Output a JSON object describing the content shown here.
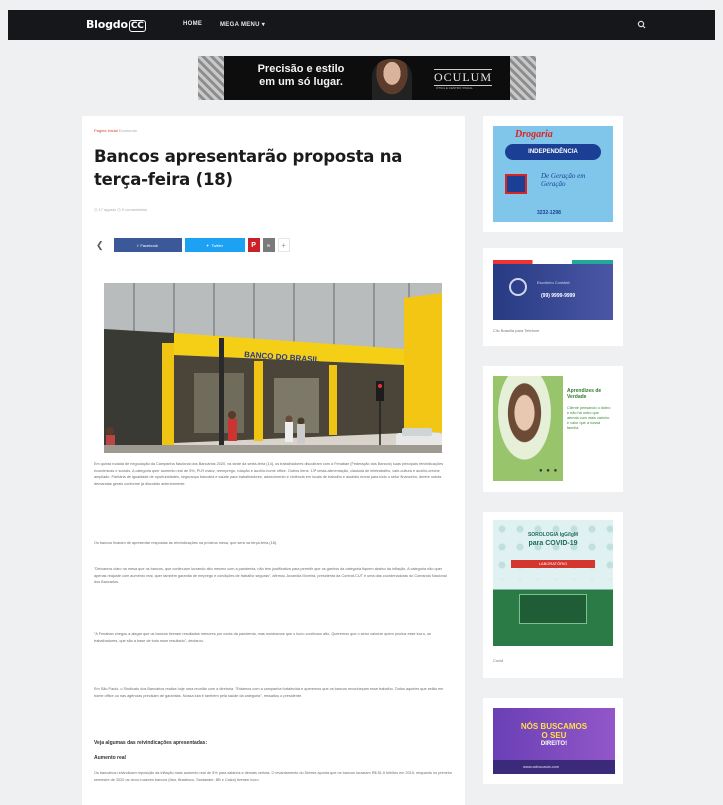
{
  "header": {
    "logo_text": "BlogdoCC",
    "logo_prefix": "Blogdo",
    "logo_mark": "CC",
    "nav": [
      "HOME",
      "MEGA MENU ▾"
    ],
    "search_icon": "search-icon"
  },
  "banner_ad": {
    "slogan_line1": "Precisão e estilo",
    "slogan_line2": "em um só lugar.",
    "brand": "OCULUM",
    "brand_sub": "ÓTICA E CENTRO VISUAL"
  },
  "article": {
    "category": "Pagina Inicial",
    "breadcrumb_sub": "Economia",
    "title": "Bancos apresentarão proposta na terça-feira (18)",
    "meta": "◷ 17 agosto  ◷ 0 comentários",
    "share": {
      "facebook": "Facebook",
      "twitter": "Twitter",
      "pinterest": "P",
      "email": "✉",
      "more": "+",
      "back": "❮"
    },
    "paragraphs": [
      "Em quinta rodada de negociação da Campanha Nacional dos Bancários 2020, na tarde da sexta-feira (14), os trabalhadores discutiram com a Fenaban (Federação dos Bancos) suas principais reivindicações econômicas e sociais. A categoria quer aumento real de 5%, PLR maior, reemprego, rotação e auxílio-home office. Outros itens: 13ª cesta-alimentação, cláusula de teletrabalho, vale-cultura e auxílio-creche ampliado. Paritária de igualdade de oportunidades, segurança bancária e saúde para trabalhadores, adoecimento e violência em locais de trabalho e assédio moral para todo o setor financeiro, dentre outras demandas gerais conforme já discutido anteriormente.",
      "Os bancos ficaram de apresentar respostas às reivindicações na próxima mesa, que será na terça-feira (18).",
      "\"Deixamos claro na mesa que os bancos, que continuam lucrando alto mesmo com a pandemia, não tem justificativa para permitir que os ganhos da categoria fiquem abaixo da inflação. A categoria não quer apenas reajuste com aumento real, quer também garantia de emprego e condições de trabalho seguras\", afirmou Juvandia Moreira, presidenta da Contraf-CUT e uma das coordenadoras do Comando Nacional dos Bancários.",
      "\"A Fenaban chegou a alegar que os bancos tiveram resultados menores por conta da pandemia, mas mostramos que o lucro continuou alto. Queremos que o setor valorize quem produz esse lucro, os trabalhadores, que são a base de todo esse resultado\", declarou.",
      "Em São Paulo, o Sindicato dos Bancários realiza hoje uma reunião com a diretoria. \"Estamos com a campanha fortalecida e queremos que os bancos reconheçam esse trabalho. Todos aqueles que estão em home office ou nas agências precisam de garantias. Nossa luta é também pela saúde da categoria\", ressaltou o presidente."
    ],
    "subheads": [
      "Veja algumas das reivindicações apresentadas:",
      "Aumento real"
    ],
    "last_paragraph": "Os bancários reivindicam reposição da inflação mais aumento real de 5% para salários e demais verbas. O levantamento do Dieese aponta que os bancos lucraram R$ 81,5 bilhões em 2019, enquanto no primeiro semestre de 2020 os cinco maiores bancos (Itaú, Bradesco, Santander, BB e Caixa) tiveram lucro"
  },
  "sidebar": {
    "ad1": {
      "top": "Drogaria",
      "mid": "INDEPENDÊNCIA",
      "script": "De Geração em Geração",
      "phone": "3232-1298"
    },
    "ad2": {
      "text": "Escritório Contábil",
      "phone": "(99) 9999-9999",
      "caption": "Clic Brasília para Telefone"
    },
    "ad3": {
      "heading": "Aprendizes de Verdade",
      "body": "Cliente pensando o dobro e não há outro que atenda com mais carinho e valor que a nossa família.",
      "caption": ""
    },
    "ad4": {
      "line1": "SOROLOGIA IgG/IgM",
      "line2": "para COVID-19",
      "badge": "LABORATÓRIO",
      "caption": "Covid"
    },
    "ad5": {
      "line1": "NÓS BUSCAMOS",
      "line2": "O SEU",
      "line3": "DIREITO!",
      "footer": "www.advocacia.com"
    }
  }
}
